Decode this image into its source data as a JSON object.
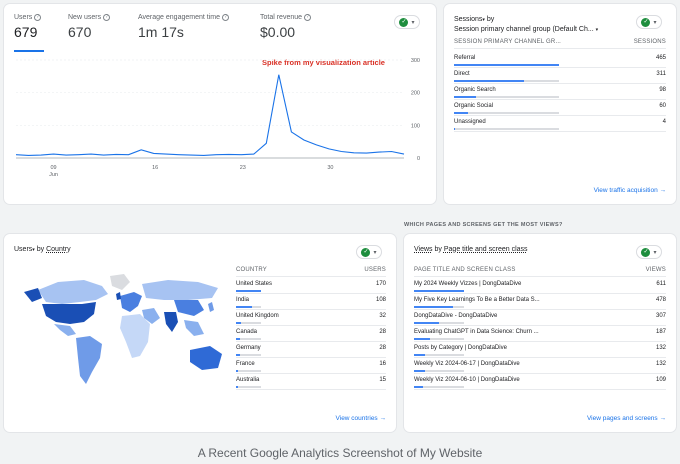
{
  "overview": {
    "metrics": [
      {
        "label": "Users",
        "value": "679"
      },
      {
        "label": "New users",
        "value": "670"
      },
      {
        "label": "Average engagement time",
        "value": "1m 17s"
      },
      {
        "label": "Total revenue",
        "value": "$0.00"
      }
    ],
    "annotation": "Spike from my visualization article"
  },
  "chart_data": {
    "type": "line",
    "x": [
      "09 Jun",
      "16",
      "23",
      "30"
    ],
    "series": [
      {
        "values": [
          10,
          8,
          9,
          12,
          9,
          10,
          12,
          9,
          11,
          10,
          25,
          14,
          12,
          10,
          9,
          8,
          10,
          11,
          10,
          12,
          45,
          255,
          80,
          55,
          40,
          28,
          20,
          16,
          15,
          18,
          20,
          12
        ]
      }
    ],
    "ylim": [
      0,
      300
    ],
    "yticks": [
      0,
      100,
      200,
      300
    ],
    "xtick_labels": [
      "09",
      "16",
      "23",
      "30"
    ],
    "xtick_sublabel": "Jun",
    "color": "#1a73e8"
  },
  "sessions": {
    "title": "Sessions",
    "by": "by",
    "dimension": "Session primary channel group (Default Ch...",
    "col_left": "SESSION PRIMARY CHANNEL GR...",
    "col_right": "SESSIONS",
    "rows": [
      {
        "label": "Referral",
        "value": "465",
        "share": 1.0
      },
      {
        "label": "Direct",
        "value": "311",
        "share": 0.67
      },
      {
        "label": "Organic Search",
        "value": "98",
        "share": 0.21
      },
      {
        "label": "Organic Social",
        "value": "60",
        "share": 0.13
      },
      {
        "label": "Unassigned",
        "value": "4",
        "share": 0.01
      }
    ],
    "link": "View traffic acquisition"
  },
  "pages_heading": "WHICH PAGES AND SCREENS GET THE MOST VIEWS?",
  "country": {
    "title": "Users",
    "by": "by",
    "dimension": "Country",
    "col_left": "COUNTRY",
    "col_right": "USERS",
    "rows": [
      {
        "label": "United States",
        "value": "170",
        "share": 1.0
      },
      {
        "label": "India",
        "value": "108",
        "share": 0.64
      },
      {
        "label": "United Kingdom",
        "value": "32",
        "share": 0.19
      },
      {
        "label": "Canada",
        "value": "28",
        "share": 0.16
      },
      {
        "label": "Germany",
        "value": "28",
        "share": 0.16
      },
      {
        "label": "France",
        "value": "16",
        "share": 0.09
      },
      {
        "label": "Australia",
        "value": "15",
        "share": 0.09
      }
    ],
    "link": "View countries"
  },
  "pages": {
    "title": "Views",
    "by": "by",
    "dimension": "Page title and screen class",
    "col_left": "PAGE TITLE AND SCREEN CLASS",
    "col_right": "VIEWS",
    "rows": [
      {
        "label": "My 2024 Weekly Vizzes | DongDataDive",
        "value": "611",
        "share": 1.0
      },
      {
        "label": "My Five Key Learnings To Be a Better Data S...",
        "value": "478",
        "share": 0.78
      },
      {
        "label": "DongDataDive - DongDataDive",
        "value": "307",
        "share": 0.5
      },
      {
        "label": "Evaluating ChatGPT in Data Science: Churn ...",
        "value": "187",
        "share": 0.31
      },
      {
        "label": "Posts by Category | DongDataDive",
        "value": "132",
        "share": 0.22
      },
      {
        "label": "Weekly Viz 2024-06-17 | DongDataDive",
        "value": "132",
        "share": 0.22
      },
      {
        "label": "Weekly Viz 2024-06-10 | DongDataDive",
        "value": "109",
        "share": 0.18
      }
    ],
    "link": "View pages and screens"
  },
  "caption": "A Recent Google Analytics Screenshot of My Website"
}
